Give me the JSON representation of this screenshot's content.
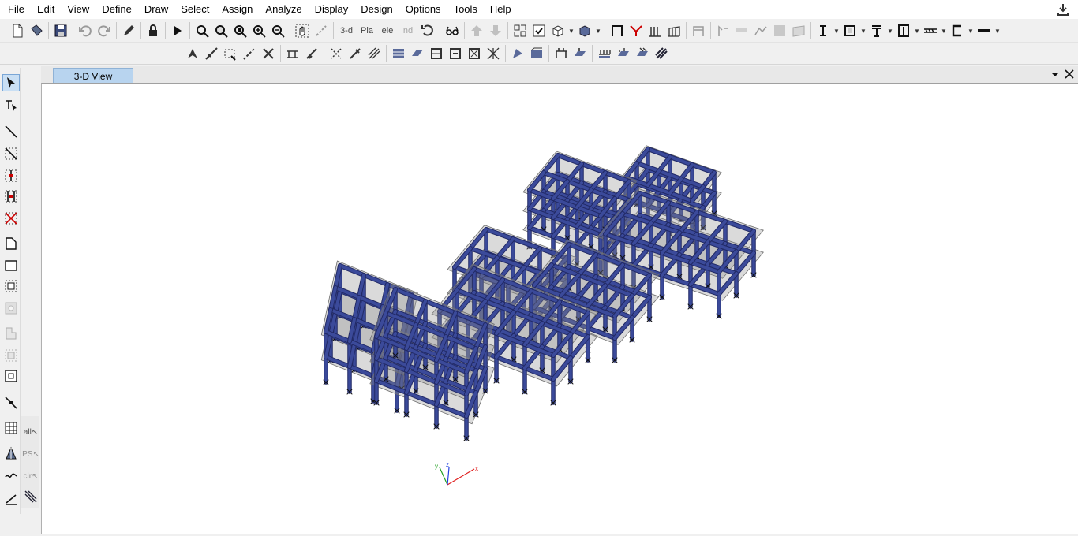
{
  "menu": {
    "items": [
      "File",
      "Edit",
      "View",
      "Define",
      "Draw",
      "Select",
      "Assign",
      "Analyze",
      "Display",
      "Design",
      "Options",
      "Tools",
      "Help"
    ]
  },
  "toolbar": {
    "view_3d_label": "3-d",
    "plan_label": "Pla",
    "elev_label": "ele",
    "nd_label": "nd"
  },
  "left_sub": {
    "all_label": "all",
    "ps_label": "PS",
    "clr_label": "clr"
  },
  "tabs": {
    "active_label": "3-D View"
  },
  "axes": {
    "x_label": "x",
    "y_label": "y",
    "z_label": "z"
  },
  "colors": {
    "frame": "#3b4a9a",
    "frame_dark": "#222a66",
    "slab": "#8c8c8c",
    "tab_active": "#b8d4ef",
    "x_axis": "#e02020",
    "y_axis": "#20a020",
    "z_axis": "#2040e0"
  }
}
